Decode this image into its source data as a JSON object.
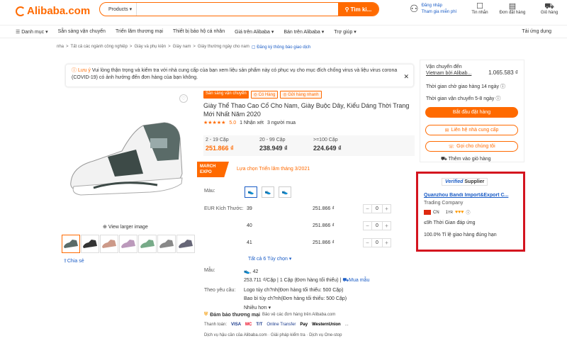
{
  "header": {
    "logo": "Alibaba.com",
    "search_category": "Products",
    "search_button": "Tìm ki...",
    "sign_in": "Đăng nhập",
    "join_free": "Tham gia miễn phí",
    "messages": "Tin nhắn",
    "orders": "Đơn đặt hàng",
    "cart": "Giỏ hàng"
  },
  "nav": {
    "items": [
      "Danh mục",
      "Sẵn sàng vận chuyển",
      "Triển lãm thương mại",
      "Thiết bị bảo hộ cá nhân",
      "Giá trên Alibaba",
      "Bán trên Alibaba",
      "Trợ giúp"
    ],
    "app": "Tải ứng dụng"
  },
  "breadcrumb": {
    "items": [
      "nha",
      "Tất cả các ngành công nghiệp",
      "Giày và phụ kiện",
      "Giày nam",
      "Giày thường ngày cho nam"
    ],
    "register": "Đăng ký thông báo giao dịch"
  },
  "notice": {
    "heading": "Lưu ý",
    "text": "Vui lòng thận trọng và kiểm tra với nhà cung cấp của bạn xem liệu sản phẩm này có phục vụ cho mục đích chống virus và liệu virus corona (COVID-19) có ảnh hưởng đến đơn hàng của bạn không."
  },
  "gallery": {
    "view_larger": "View larger image",
    "share": "Chia sẻ"
  },
  "product": {
    "tag1": "Sẵn sàng vận chuyển",
    "tag2": "Có Hàng",
    "tag3": "Gửi hàng nhanh",
    "title": "Giày Thể Thao Cao Cổ Cho Nam, Giày Buộc Dây, Kiểu Dáng Thời Trang Mới Nhất Năm 2020",
    "rating": "5.0",
    "reviews": "1 Nhận xét",
    "buyers": "3 người mua",
    "tiers": [
      {
        "qty": "2 - 19 Cặp",
        "price": "251.866 ₫"
      },
      {
        "qty": "20 - 99 Cặp",
        "price": "238.949 ₫"
      },
      {
        "qty": ">=100 Cặp",
        "price": "224.649 ₫"
      }
    ],
    "expo_badge": "MARCH EXPO",
    "expo_text": "Lựa chọn Triển lãm tháng 3/2021",
    "color_label": "Màu:",
    "size_label": "EUR Kích Thước:",
    "sizes": [
      {
        "size": "39",
        "price": "251.866 ₫",
        "qty": "0"
      },
      {
        "size": "40",
        "price": "251.866 ₫",
        "qty": "0"
      },
      {
        "size": "41",
        "price": "251.866 ₫",
        "qty": "0"
      }
    ],
    "more_variants": "Tất cả 6 Tùy chọn",
    "sample_label": "Mẫu:",
    "sample_variant": ", 42",
    "sample_price": "253.711 ₫/Cặp | 1 Cặp (Đơn hàng tối thiểu) |",
    "buy_sample": "Mua mẫu",
    "custom_label": "Theo yêu cầu:",
    "custom_items": [
      "Logo tùy ch?nh(Đơn hàng tối thiểu: 500 Cặp)",
      "Bao bì tùy ch?nh(Đơn hàng tối thiểu: 500 Cặp)",
      "Nhiều hơn"
    ],
    "protection": "Đảm bảo thương mại",
    "protection_sub": "Bảo vệ các đơn hàng trên Alibaba.com",
    "payment_label": "Thanh toán:",
    "payments": [
      "VISA",
      "MC",
      "T/T",
      "Online Transfer",
      "Pay",
      "WesternUnion",
      "..."
    ],
    "services": "Dịch vụ hậu cần của Alibaba.com  ·  Giải pháp kiểm tra  ·  Dịch vụ One-stop"
  },
  "side": {
    "ship_to": "Vận chuyển đến",
    "ship_via": "Vietnam bởi Alibab...",
    "ship_cost": "1.065.583 ₫",
    "lead_time": "Thời gian chờ giao hàng 14 ngày",
    "ship_time": "Thời gian vận chuyển 5-8 ngày",
    "start_order": "Bắt đầu đặt hàng",
    "contact": "Liên hệ nhà cung cấp",
    "call": "Gọi cho chúng tôi",
    "add_cart": "Thêm vào giỏ hàng"
  },
  "supplier": {
    "verified": "Verified",
    "verified2": "Supplier",
    "name": "Quanzhou Bandi Import&Export C...",
    "type": "Trading Company",
    "country": "CN",
    "years": "1",
    "years_unit": "YR",
    "response_metric": "≤9h",
    "response_label": "Thời Gian đáp ứng",
    "ontime_metric": "100.0%",
    "ontime_label": "Tỉ lệ giao hàng đúng hạn"
  }
}
